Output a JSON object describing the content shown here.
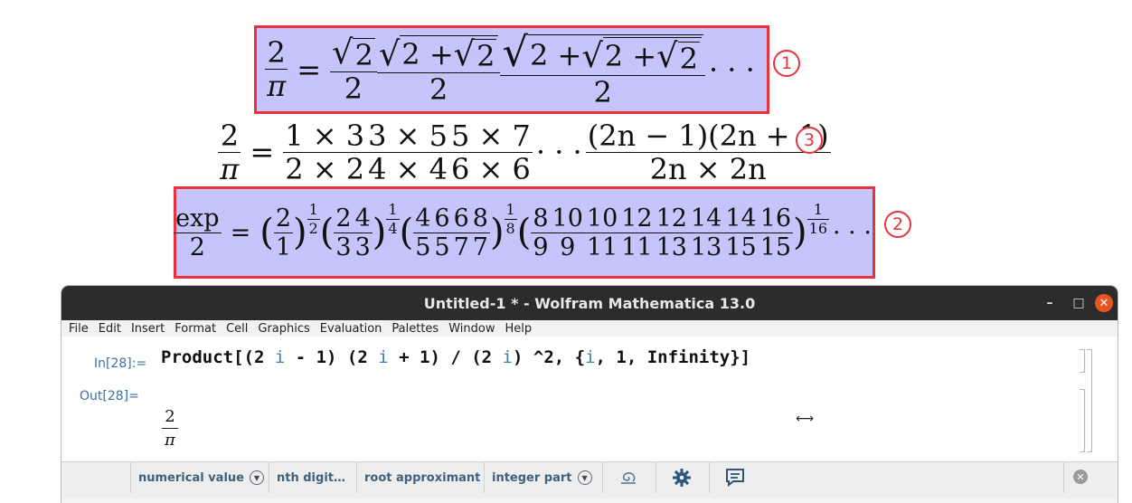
{
  "formula1": {
    "lhs_num": "2",
    "lhs_den": "π",
    "eq": "=",
    "t1_num": "2",
    "t1_den": "2",
    "t2_inner": "2 + ",
    "t2_root": "2",
    "t2_den": "2",
    "t3_inner": "2 + ",
    "t3_mid": "2 + ",
    "t3_root": "2",
    "t3_den": "2",
    "dots": "· · ·",
    "badge": "1"
  },
  "formula3": {
    "lhs_num": "2",
    "lhs_den": "π",
    "eq": "=",
    "fracs": [
      {
        "num": "1 × 3",
        "den": "2 × 2"
      },
      {
        "num": "3 × 5",
        "den": "4 × 4"
      },
      {
        "num": "5 × 7",
        "den": "6 × 6"
      }
    ],
    "dots": "· · ·",
    "last_num": "(2n − 1)(2n + 1)",
    "last_den": "2n × 2n",
    "badge": "3"
  },
  "formula2": {
    "lhs_num": "exp",
    "lhs_den": "2",
    "eq": "=",
    "g1": [
      {
        "num": "2",
        "den": "1"
      }
    ],
    "g1_exp_num": "1",
    "g1_exp_den": "2",
    "g2": [
      {
        "num": "2",
        "den": "3"
      },
      {
        "num": "4",
        "den": "3"
      }
    ],
    "g2_exp_num": "1",
    "g2_exp_den": "4",
    "g3": [
      {
        "num": "4",
        "den": "5"
      },
      {
        "num": "6",
        "den": "5"
      },
      {
        "num": "6",
        "den": "7"
      },
      {
        "num": "8",
        "den": "7"
      }
    ],
    "g3_exp_num": "1",
    "g3_exp_den": "8",
    "g4": [
      {
        "num": "8",
        "den": "9"
      },
      {
        "num": "10",
        "den": "9"
      },
      {
        "num": "10",
        "den": "11"
      },
      {
        "num": "12",
        "den": "11"
      },
      {
        "num": "12",
        "den": "13"
      },
      {
        "num": "14",
        "den": "13"
      },
      {
        "num": "14",
        "den": "15"
      },
      {
        "num": "16",
        "den": "15"
      }
    ],
    "g4_exp_num": "1",
    "g4_exp_den": "16",
    "dots": "· · ·",
    "badge": "2"
  },
  "window": {
    "title": "Untitled-1 * - Wolfram Mathematica 13.0",
    "controls": {
      "min": "–",
      "max": "□",
      "close": "✕"
    },
    "menu": [
      "File",
      "Edit",
      "Insert",
      "Format",
      "Cell",
      "Graphics",
      "Evaluation",
      "Palettes",
      "Window",
      "Help"
    ]
  },
  "notebook": {
    "in_label": "In[28]:=",
    "out_label": "Out[28]=",
    "code": {
      "p1": "Product[(2 ",
      "v1": "i",
      "p2": " - 1) (2 ",
      "v2": "i",
      "p3": " + 1) / (2 ",
      "v3": "i",
      "p4": ") ^2, {",
      "v4": "i",
      "p5": ", 1, Infinity}]"
    },
    "output_num": "2",
    "output_den": "π"
  },
  "suggestions_bar": {
    "items": [
      "numerical value",
      "nth digit…",
      "root approximant",
      "integer part"
    ],
    "icons": [
      "undo-spiral-icon",
      "settings-gear-icon",
      "feedback-chat-icon",
      "close-circle-icon"
    ]
  }
}
